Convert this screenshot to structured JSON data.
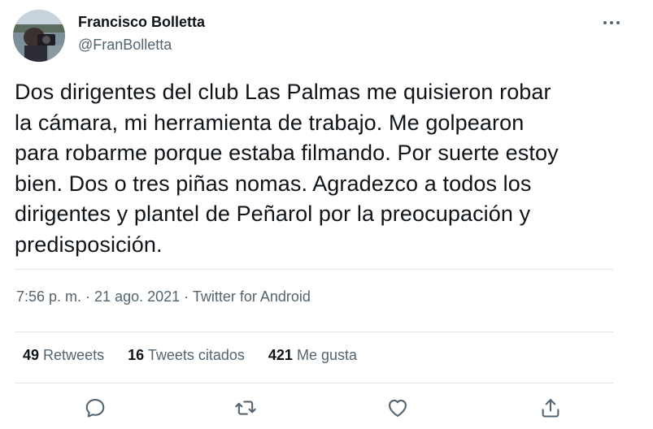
{
  "author": {
    "display_name": "Francisco Bolletta",
    "handle": "@FranBolletta"
  },
  "tweet": {
    "lines": [
      "Dos dirigentes del club Las Palmas me quisieron robar",
      "la cámara, mi herramienta de trabajo. Me golpearon",
      "para robarme porque estaba filmando. Por suerte estoy",
      "bien. Dos o tres piñas nomas. Agradezco a todos los",
      "dirigentes y plantel de Peñarol por la preocupación y",
      "predisposición."
    ]
  },
  "meta": {
    "time": "7:56 p. m.",
    "separator": " · ",
    "date": "21 ago. 2021",
    "source": "Twitter for Android"
  },
  "stats": {
    "retweets": {
      "count": "49",
      "label": "Retweets"
    },
    "quotes": {
      "count": "16",
      "label": "Tweets citados"
    },
    "likes": {
      "count": "421",
      "label": "Me gusta"
    }
  },
  "actions": {
    "reply_icon": "reply-icon",
    "retweet_icon": "retweet-icon",
    "like_icon": "heart-icon",
    "share_icon": "share-icon",
    "more_icon": "more-icon"
  },
  "colors": {
    "text": "#0f1419",
    "secondary": "#536471",
    "divider": "#e1e8ed"
  }
}
